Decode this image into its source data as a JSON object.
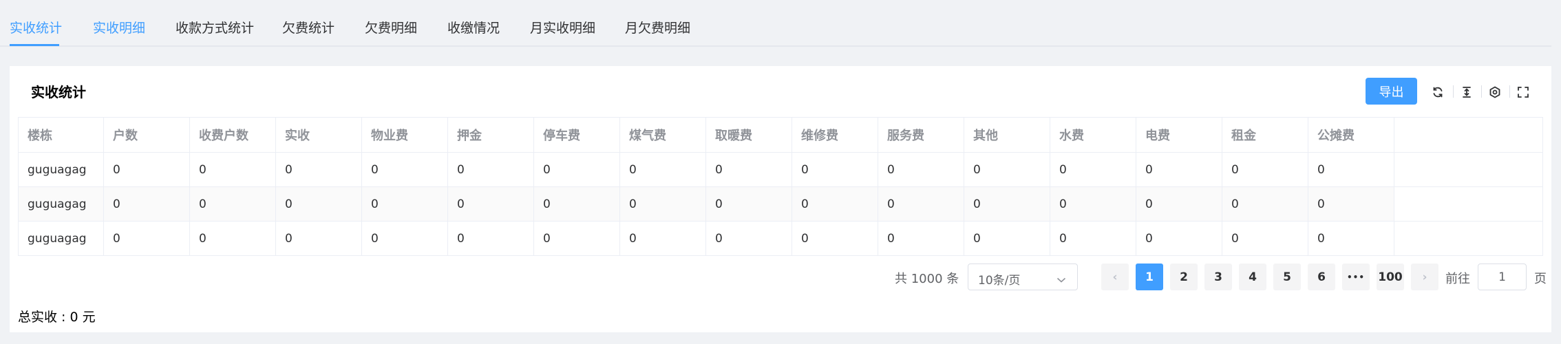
{
  "tabs": [
    {
      "label": "实收统计",
      "active": true
    },
    {
      "label": "实收明细"
    },
    {
      "label": "收款方式统计"
    },
    {
      "label": "欠费统计"
    },
    {
      "label": "欠费明细"
    },
    {
      "label": "收缴情况"
    },
    {
      "label": "月实收明细"
    },
    {
      "label": "月欠费明细"
    }
  ],
  "card": {
    "title": "实收统计",
    "export_label": "导出",
    "tools": [
      "refresh-icon",
      "column-height-icon",
      "settings-icon",
      "fullscreen-icon"
    ]
  },
  "table": {
    "columns": [
      "楼栋",
      "户数",
      "收费户数",
      "实收",
      "物业费",
      "押金",
      "停车费",
      "煤气费",
      "取暖费",
      "维修费",
      "服务费",
      "其他",
      "水费",
      "电费",
      "租金",
      "公摊费"
    ],
    "rows": [
      [
        "guguagag",
        "0",
        "0",
        "0",
        "0",
        "0",
        "0",
        "0",
        "0",
        "0",
        "0",
        "0",
        "0",
        "0",
        "0",
        "0"
      ],
      [
        "guguagag",
        "0",
        "0",
        "0",
        "0",
        "0",
        "0",
        "0",
        "0",
        "0",
        "0",
        "0",
        "0",
        "0",
        "0",
        "0"
      ],
      [
        "guguagag",
        "0",
        "0",
        "0",
        "0",
        "0",
        "0",
        "0",
        "0",
        "0",
        "0",
        "0",
        "0",
        "0",
        "0",
        "0"
      ]
    ]
  },
  "pagination": {
    "total": "共 1000 条",
    "page_size": "10条/页",
    "prev": "‹",
    "pages": [
      "1",
      "2",
      "3",
      "4",
      "5",
      "6"
    ],
    "ellipsis": "•••",
    "last": "100",
    "next": "›",
    "current": "1",
    "goto_label": "前往",
    "goto_value": "1",
    "page_suffix": "页"
  },
  "summary": "总实收 : 0 元",
  "colors": {
    "primary": "#409eff",
    "border": "#ebeef5",
    "header_text": "#909399",
    "background": "#f0f2f5"
  }
}
